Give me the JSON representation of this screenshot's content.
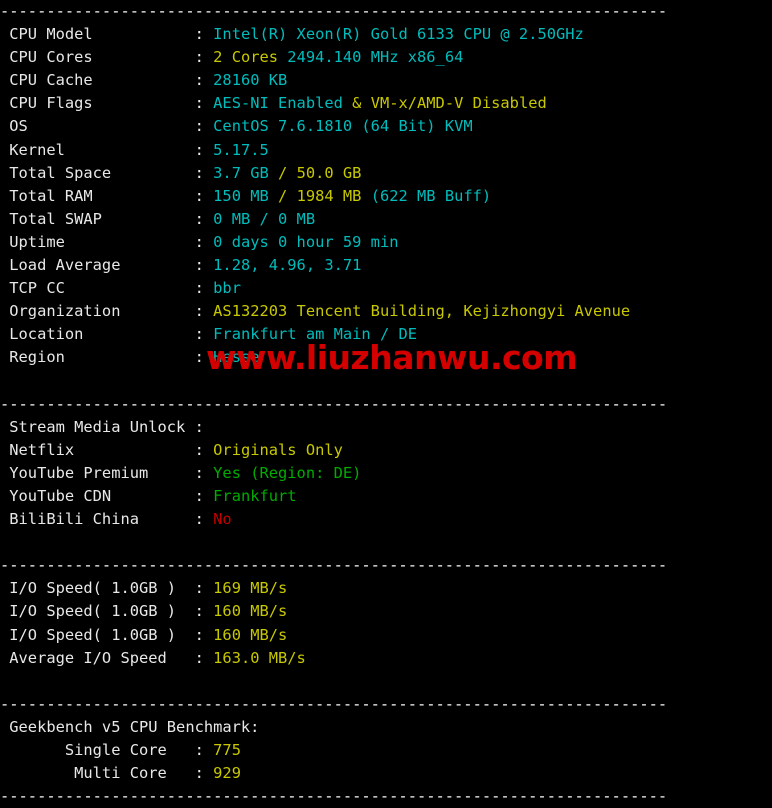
{
  "terminal": {
    "separator": "------------------------------------------------------------------------",
    "colon": ":",
    "label_width": 21,
    "colors": {
      "cyan": "#00bcbc",
      "yellow": "#c8c800",
      "green": "#00ac00",
      "red": "#c00000",
      "white": "#e8e8e8",
      "background": "#000000",
      "watermark": "#d40000"
    }
  },
  "watermark": {
    "text": "www.liuzhanwu.com"
  },
  "sections": [
    {
      "id": "system-info",
      "rows": [
        {
          "label": "CPU Model",
          "parts": [
            {
              "text": "Intel(R) Xeon(R) Gold 6133 CPU @ 2.50GHz",
              "color": "cy"
            }
          ]
        },
        {
          "label": "CPU Cores",
          "parts": [
            {
              "text": "2 Cores ",
              "color": "ye"
            },
            {
              "text": "2494.140 MHz x86_64",
              "color": "cy"
            }
          ]
        },
        {
          "label": "CPU Cache",
          "parts": [
            {
              "text": "28160 KB",
              "color": "cy"
            }
          ]
        },
        {
          "label": "CPU Flags",
          "parts": [
            {
              "text": "AES-NI Enabled ",
              "color": "cy"
            },
            {
              "text": "& VM-x/AMD-V Disabled",
              "color": "ye"
            }
          ]
        },
        {
          "label": "OS",
          "parts": [
            {
              "text": "CentOS 7.6.1810 (64 Bit) KVM",
              "color": "cy"
            }
          ]
        },
        {
          "label": "Kernel",
          "parts": [
            {
              "text": "5.17.5",
              "color": "cy"
            }
          ]
        },
        {
          "label": "Total Space",
          "parts": [
            {
              "text": "3.7 GB ",
              "color": "cy"
            },
            {
              "text": "/ 50.0 GB",
              "color": "ye"
            }
          ]
        },
        {
          "label": "Total RAM",
          "parts": [
            {
              "text": "150 MB ",
              "color": "cy"
            },
            {
              "text": "/ 1984 MB ",
              "color": "ye"
            },
            {
              "text": "(622 MB Buff)",
              "color": "cy"
            }
          ]
        },
        {
          "label": "Total SWAP",
          "parts": [
            {
              "text": "0 MB / 0 MB",
              "color": "cy"
            }
          ]
        },
        {
          "label": "Uptime",
          "parts": [
            {
              "text": "0 days 0 hour 59 min",
              "color": "cy"
            }
          ]
        },
        {
          "label": "Load Average",
          "parts": [
            {
              "text": "1.28, 4.96, 3.71",
              "color": "cy"
            }
          ]
        },
        {
          "label": "TCP CC",
          "parts": [
            {
              "text": "bbr",
              "color": "cy"
            }
          ]
        },
        {
          "label": "Organization",
          "parts": [
            {
              "text": "AS132203 Tencent Building, Kejizhongyi Avenue",
              "color": "ye"
            }
          ]
        },
        {
          "label": "Location",
          "parts": [
            {
              "text": "Frankfurt am Main / DE",
              "color": "cy"
            }
          ]
        },
        {
          "label": "Region",
          "parts": [
            {
              "text": "Hesse",
              "color": "cy"
            }
          ]
        }
      ]
    },
    {
      "id": "stream-media-unlock",
      "rows": [
        {
          "label": "Stream Media Unlock",
          "parts": [
            {
              "text": "",
              "color": "wh"
            }
          ]
        },
        {
          "label": "Netflix",
          "parts": [
            {
              "text": "Originals Only",
              "color": "ye"
            }
          ]
        },
        {
          "label": "YouTube Premium",
          "parts": [
            {
              "text": "Yes (Region: DE)",
              "color": "gr"
            }
          ]
        },
        {
          "label": "YouTube CDN",
          "parts": [
            {
              "text": "Frankfurt",
              "color": "gr"
            }
          ]
        },
        {
          "label": "BiliBili China",
          "parts": [
            {
              "text": "No",
              "color": "rd"
            }
          ]
        }
      ]
    },
    {
      "id": "io-speed",
      "rows": [
        {
          "label": "I/O Speed( 1.0GB )",
          "parts": [
            {
              "text": "169 MB/s",
              "color": "ye"
            }
          ]
        },
        {
          "label": "I/O Speed( 1.0GB )",
          "parts": [
            {
              "text": "160 MB/s",
              "color": "ye"
            }
          ]
        },
        {
          "label": "I/O Speed( 1.0GB )",
          "parts": [
            {
              "text": "160 MB/s",
              "color": "ye"
            }
          ]
        },
        {
          "label": "Average I/O Speed",
          "parts": [
            {
              "text": "163.0 MB/s",
              "color": "ye"
            }
          ]
        }
      ]
    },
    {
      "id": "geekbench",
      "heading": "Geekbench v5 CPU Benchmark:",
      "rows": [
        {
          "label": "      Single Core",
          "parts": [
            {
              "text": "775",
              "color": "ye"
            }
          ]
        },
        {
          "label": "       Multi Core",
          "parts": [
            {
              "text": "929",
              "color": "ye"
            }
          ]
        }
      ]
    }
  ]
}
